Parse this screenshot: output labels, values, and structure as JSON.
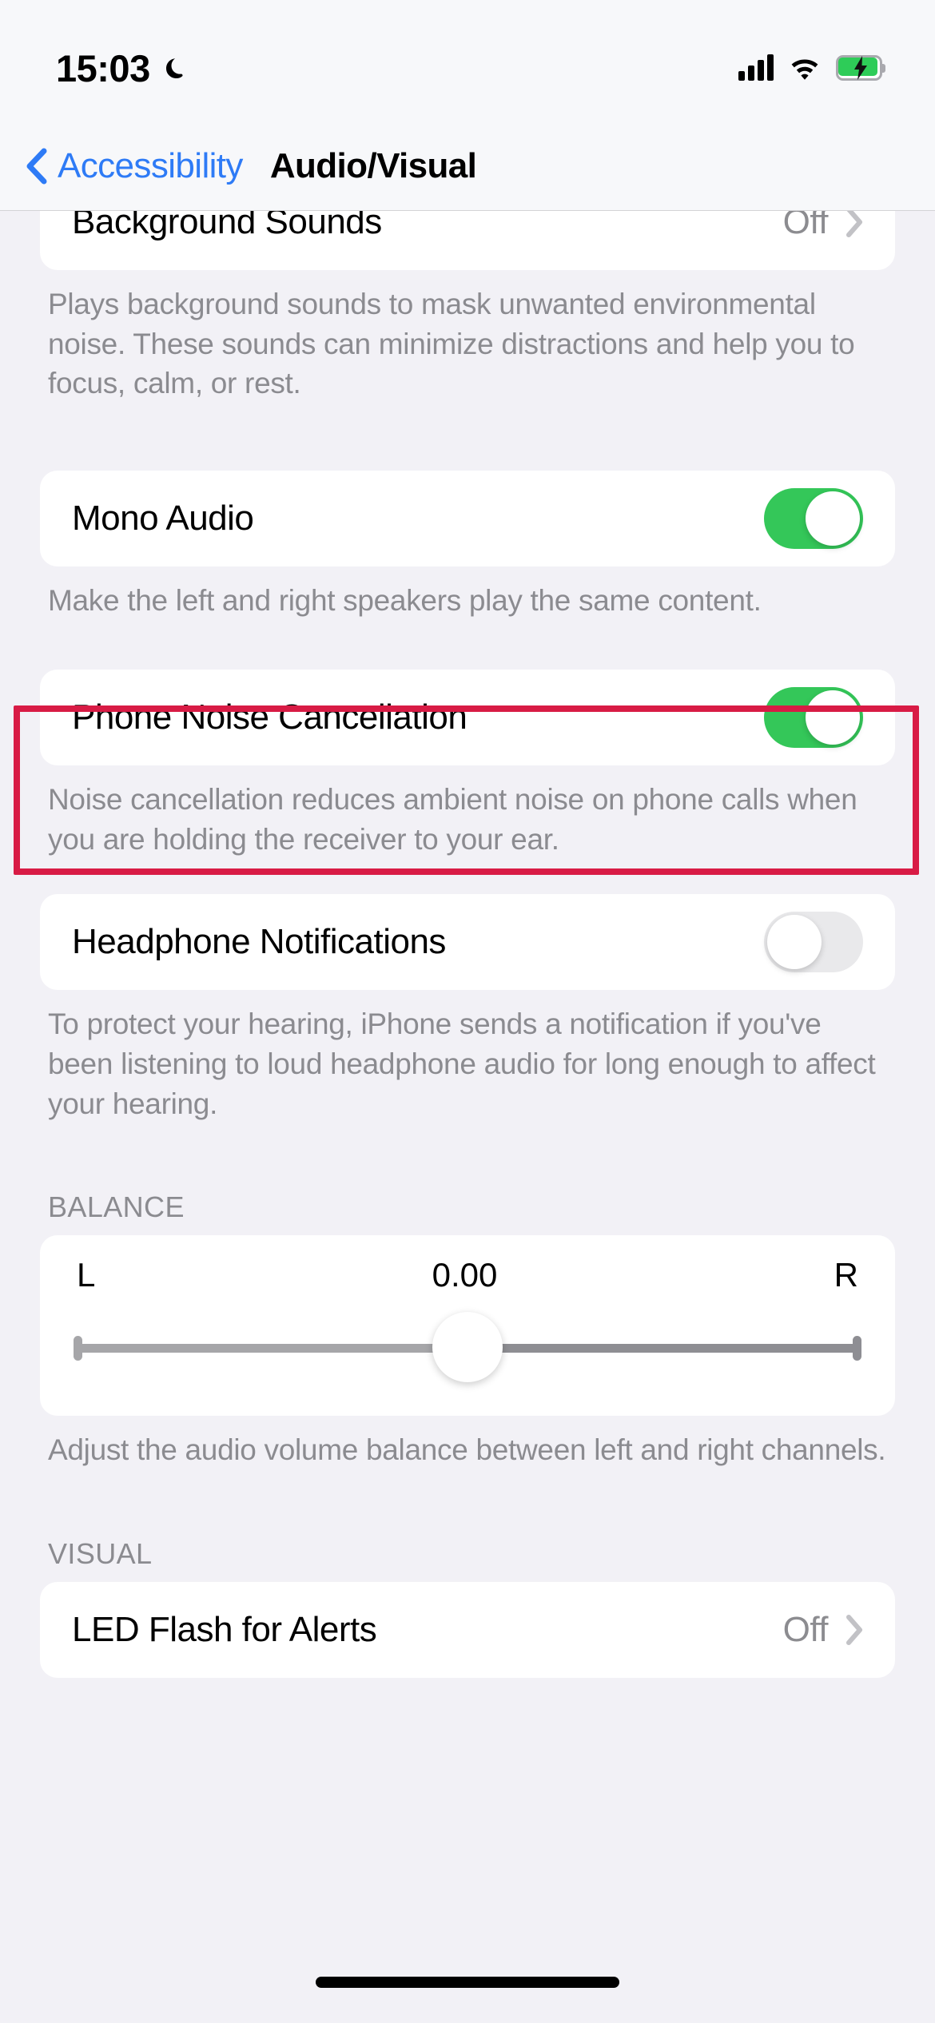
{
  "status_bar": {
    "time": "15:03",
    "dnd_icon": "crescent-moon-icon",
    "signal_icon": "cellular-signal-icon",
    "wifi_icon": "wifi-icon",
    "battery_icon": "battery-charging-icon"
  },
  "nav": {
    "back_label": "Accessibility",
    "back_icon": "chevron-left-icon",
    "title": "Audio/Visual"
  },
  "rows": {
    "background_sounds": {
      "label": "Background Sounds",
      "value": "Off",
      "footnote": "Plays background sounds to mask unwanted environmental noise. These sounds can minimize distractions and help you to focus, calm, or rest."
    },
    "mono_audio": {
      "label": "Mono Audio",
      "state": "on",
      "footnote": "Make the left and right speakers play the same content."
    },
    "phone_noise_cancellation": {
      "label": "Phone Noise Cancellation",
      "state": "on",
      "footnote": "Noise cancellation reduces ambient noise on phone calls when you are holding the receiver to your ear."
    },
    "headphone_notifications": {
      "label": "Headphone Notifications",
      "state": "off",
      "footnote": "To protect your hearing, iPhone sends a notification if you've been listening to loud headphone audio for long enough to affect your hearing."
    },
    "led_flash": {
      "label": "LED Flash for Alerts",
      "value": "Off"
    }
  },
  "balance": {
    "header": "BALANCE",
    "left_label": "L",
    "value": "0.00",
    "right_label": "R",
    "footnote": "Adjust the audio volume balance between left and right channels."
  },
  "visual": {
    "header": "VISUAL"
  },
  "colors": {
    "accent_blue": "#2E7BF6",
    "toggle_on_green": "#34C759",
    "highlight_red": "#D81B45",
    "page_background": "#F2F1F6",
    "card_background": "#FFFFFF",
    "secondary_text": "#8B8B90"
  }
}
